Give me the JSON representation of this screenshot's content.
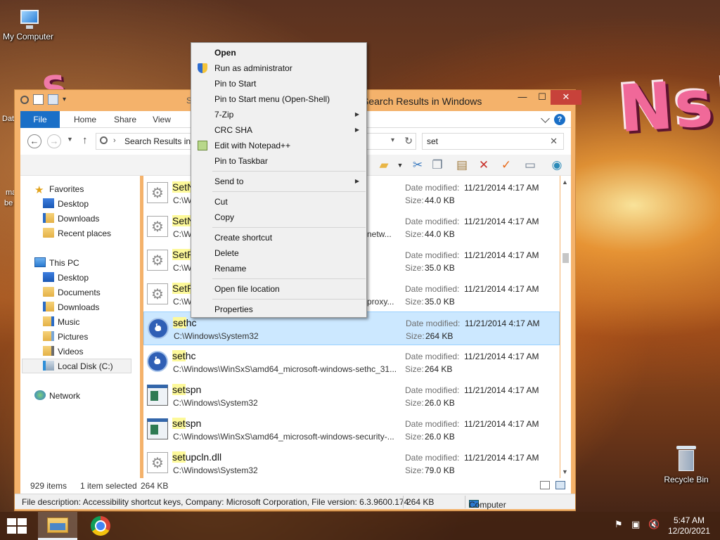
{
  "desktop": {
    "icons": [
      {
        "label": "My Computer"
      },
      {
        "label": "Recycle Bin"
      }
    ],
    "cut_labels": [
      "Dat",
      "ma",
      "be"
    ],
    "wallpaper_text": "Ns!",
    "wallpaper_text_left": "S"
  },
  "window": {
    "title": "Search Results in Windows",
    "title_fragment": "S",
    "controls": {
      "minimize": "—",
      "maximize": "☐",
      "close": "✕"
    },
    "ribbon_tabs": [
      "File",
      "Home",
      "Share",
      "View"
    ],
    "help": "?",
    "address_text": "Search Results in W",
    "search_value": "set",
    "nav_pane": {
      "favorites": "Favorites",
      "favorites_items": [
        "Desktop",
        "Downloads",
        "Recent places"
      ],
      "this_pc": "This PC",
      "this_pc_items": [
        "Desktop",
        "Documents",
        "Downloads",
        "Music",
        "Pictures",
        "Videos",
        "Local Disk (C:)"
      ],
      "network": "Network"
    },
    "date_label": "Date modified:",
    "size_label": "Size:",
    "files": [
      {
        "name_hl": "SetN",
        "name_rest": "",
        "path": "C:\\W",
        "path_tail": "",
        "date": "11/21/2014 4:17 AM",
        "size": "44.0 KB",
        "icon": "gear"
      },
      {
        "name_hl": "SetN",
        "name_rest": "",
        "path": "C:\\W",
        "path_tail": "netw...",
        "date": "11/21/2014 4:17 AM",
        "size": "44.0 KB",
        "icon": "gear"
      },
      {
        "name_hl": "SetP",
        "name_rest": "",
        "path": "C:\\W",
        "path_tail": "",
        "date": "11/21/2014 4:17 AM",
        "size": "35.0 KB",
        "icon": "gear"
      },
      {
        "name_hl": "SetP",
        "name_rest": "",
        "path": "C:\\W",
        "path_tail": "proxy...",
        "date": "11/21/2014 4:17 AM",
        "size": "35.0 KB",
        "icon": "gear"
      },
      {
        "name_hl": "set",
        "name_rest": "hc",
        "path": "C:\\Windows\\System32",
        "path_tail": "",
        "date": "11/21/2014 4:17 AM",
        "size": "264 KB",
        "icon": "sethc"
      },
      {
        "name_hl": "set",
        "name_rest": "hc",
        "path": "C:\\Windows\\WinSxS\\amd64_microsoft-windows-sethc_31...",
        "path_tail": "",
        "date": "11/21/2014 4:17 AM",
        "size": "264 KB",
        "icon": "sethc"
      },
      {
        "name_hl": "set",
        "name_rest": "spn",
        "path": "C:\\Windows\\System32",
        "path_tail": "",
        "date": "11/21/2014 4:17 AM",
        "size": "26.0 KB",
        "icon": "app"
      },
      {
        "name_hl": "set",
        "name_rest": "spn",
        "path": "C:\\Windows\\WinSxS\\amd64_microsoft-windows-security-...",
        "path_tail": "",
        "date": "11/21/2014 4:17 AM",
        "size": "26.0 KB",
        "icon": "app"
      },
      {
        "name_hl": "set",
        "name_rest": "upcln.dll",
        "path": "C:\\Windows\\System32",
        "path_tail": "",
        "date": "11/21/2014 4:17 AM",
        "size": "79.0 KB",
        "icon": "gear"
      }
    ],
    "selected_index": 4,
    "status": {
      "items": "929 items",
      "selected": "1 item selected",
      "size": "264 KB"
    },
    "details": {
      "description": "File description: Accessibility shortcut keys, Company: Microsoft Corporation, File version: 6.3.9600.174",
      "size": "264 KB",
      "location": "Computer"
    }
  },
  "context_menu": {
    "items": [
      {
        "label": "Open",
        "bold": true
      },
      {
        "label": "Run as administrator",
        "icon": "shield"
      },
      {
        "label": "Pin to Start"
      },
      {
        "label": "Pin to Start menu (Open-Shell)"
      },
      {
        "label": "7-Zip",
        "submenu": true
      },
      {
        "label": "CRC SHA",
        "submenu": true
      },
      {
        "label": "Edit with Notepad++",
        "icon": "notepadpp"
      },
      {
        "label": "Pin to Taskbar"
      },
      {
        "label": "Send to",
        "submenu": true
      },
      {
        "label": "Cut"
      },
      {
        "label": "Copy"
      },
      {
        "label": "Create shortcut"
      },
      {
        "label": "Delete"
      },
      {
        "label": "Rename"
      },
      {
        "label": "Open file location"
      },
      {
        "label": "Properties"
      }
    ]
  },
  "taskbar": {
    "time": "5:47 AM",
    "date": "12/20/2021"
  },
  "colors": {
    "window_frame": "#f4b26b",
    "accent": "#1a6fc7",
    "selection": "#cce8ff",
    "highlight": "#fdf99a"
  }
}
